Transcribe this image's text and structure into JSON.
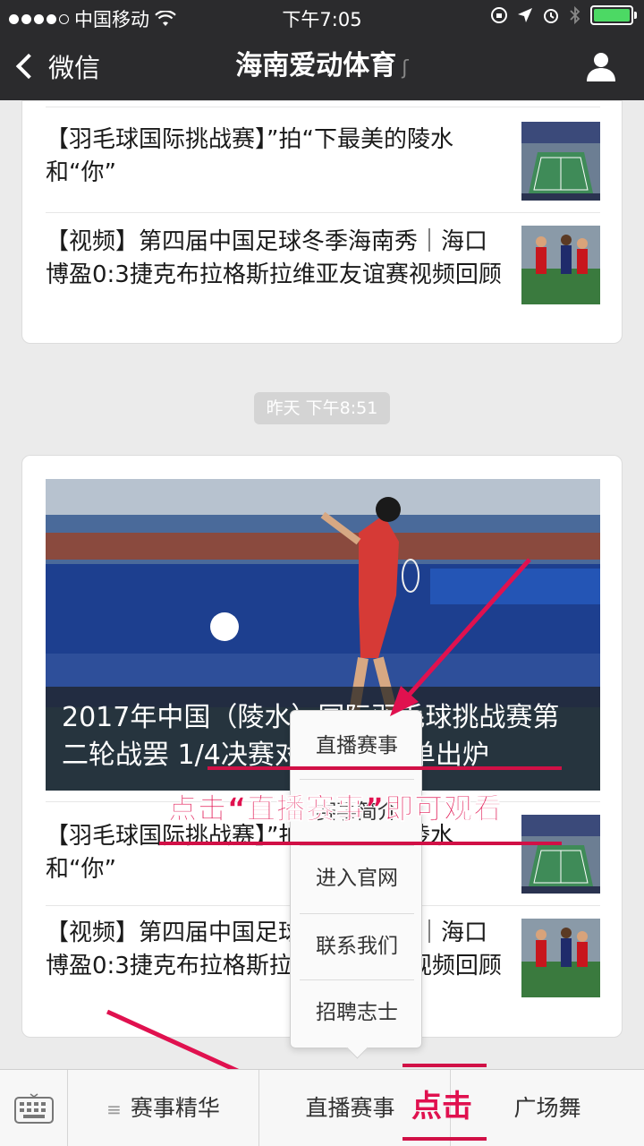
{
  "status_bar": {
    "carrier": "中国移动",
    "time": "下午7:05"
  },
  "nav": {
    "back_label": "微信",
    "title": "海南爱动体育"
  },
  "messages_top": {
    "items": [
      {
        "title": "【羽毛球国际挑战赛】”拍“下最美的陵水和“你”",
        "thumb_icon": "badminton-court-icon"
      },
      {
        "title": "【视频】第四届中国足球冬季海南秀｜海口博盈0:3捷克布拉格斯拉维亚友谊赛视频回顾",
        "thumb_icon": "football-match-icon"
      }
    ]
  },
  "timestamp": "昨天 下午8:51",
  "messages_bottom": {
    "hero_caption": "2017年中国（陵水）国际羽毛球挑战赛第二轮战罢 1/4决赛对阵选手名单出炉",
    "items": [
      {
        "title": "【羽毛球国际挑战赛】”拍“下最美的陵水和“你”",
        "thumb_icon": "badminton-court-icon"
      },
      {
        "title": "【视频】第四届中国足球冬季海南秀｜海口博盈0:3捷克布拉格斯拉维亚友谊赛视频回顾",
        "thumb_icon": "football-match-icon"
      }
    ]
  },
  "popup_menu": {
    "items": [
      "直播赛事",
      "赛事简介",
      "进入官网",
      "联系我们",
      "招聘志士"
    ]
  },
  "annotations": {
    "instruction": "点击“直播赛事”即可观看",
    "click_label": "点击"
  },
  "bottom_menu": {
    "items": [
      "赛事精华",
      "直播赛事",
      "广场舞"
    ]
  },
  "colors": {
    "nav_bg": "#2b2b2d",
    "annotation": "#e0114f",
    "battery": "#4cd964"
  }
}
